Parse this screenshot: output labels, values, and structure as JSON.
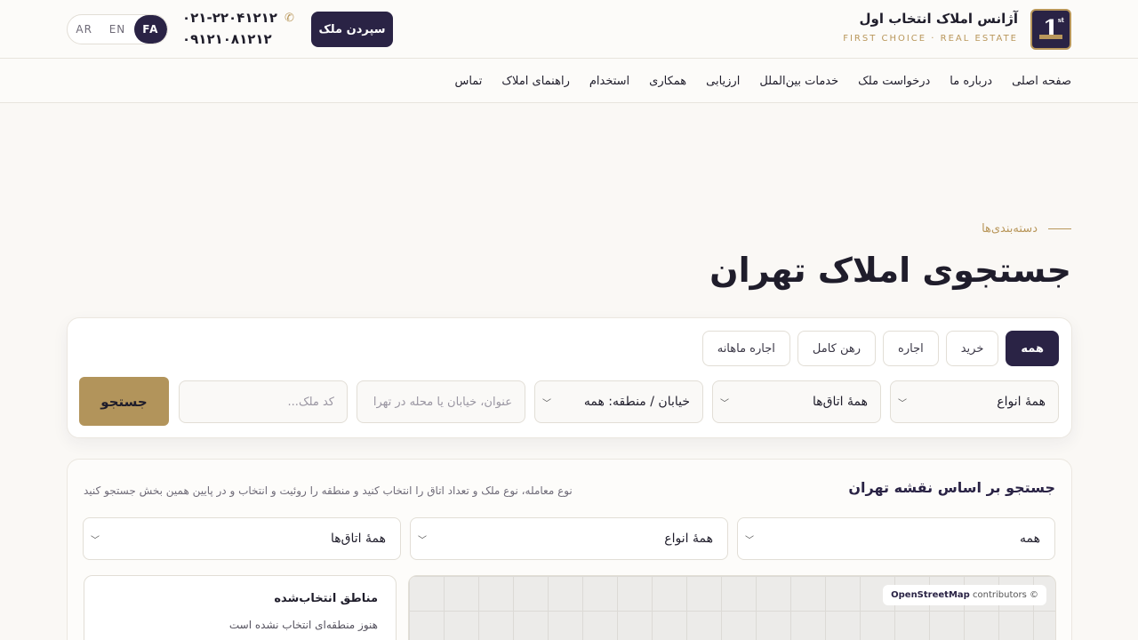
{
  "header": {
    "brand_title": "آژانس املاک انتخاب اول",
    "brand_subtitle": "FIRST CHOICE · REAL ESTATE",
    "logo_text": "1",
    "logo_sup": "st",
    "phones": [
      "۰۲۱-۲۲۰۴۱۲۱۲",
      "۰۹۱۲۱۰۸۱۲۱۲"
    ],
    "deposit_button": "سپردن ملک",
    "languages": [
      {
        "label": "AR",
        "active": false
      },
      {
        "label": "EN",
        "active": false
      },
      {
        "label": "FA",
        "active": true
      }
    ]
  },
  "nav": {
    "items": [
      "صفحه اصلی",
      "درباره ما",
      "درخواست ملک",
      "خدمات بین‌الملل",
      "ارزیابی",
      "همکاری",
      "استخدام",
      "راهنمای املاک",
      "تماس"
    ]
  },
  "hero": {
    "eyebrow": "دسته‌بندی‌ها",
    "title": "جستجوی املاک تهران"
  },
  "search": {
    "tabs": [
      {
        "label": "همه",
        "active": true
      },
      {
        "label": "خرید",
        "active": false
      },
      {
        "label": "اجاره",
        "active": false
      },
      {
        "label": "رهن کامل",
        "active": false
      },
      {
        "label": "اجاره ماهانه",
        "active": false
      }
    ],
    "type_select": "همهٔ انواع",
    "rooms_select": "همهٔ اتاق‌ها",
    "area_select": "خیابان / منطقه: همه",
    "title_placeholder": "عنوان، خیابان یا محله در تهرا",
    "code_placeholder": "کد ملک...",
    "search_button": "جستجو"
  },
  "map_section": {
    "title": "جستجو بر اساس نقشه تهران",
    "hint": "نوع معامله، نوع ملک و تعداد اتاق را انتخاب کنید و منطقه را روئیت و انتخاب و در پایین همین بخش جستجو کنید",
    "deal_select": "همه",
    "type_select": "همهٔ انواع",
    "rooms_select": "همهٔ اتاق‌ها",
    "selected_title": "مناطق انتخاب‌شده",
    "selected_empty": "هنوز منطقه‌ای انتخاب نشده است",
    "osm_brand": "OpenStreetMap",
    "osm_rest": "contributors ©"
  },
  "colors": {
    "primary": "#2a2345",
    "accent": "#b9975b",
    "background": "#faf8f5"
  }
}
